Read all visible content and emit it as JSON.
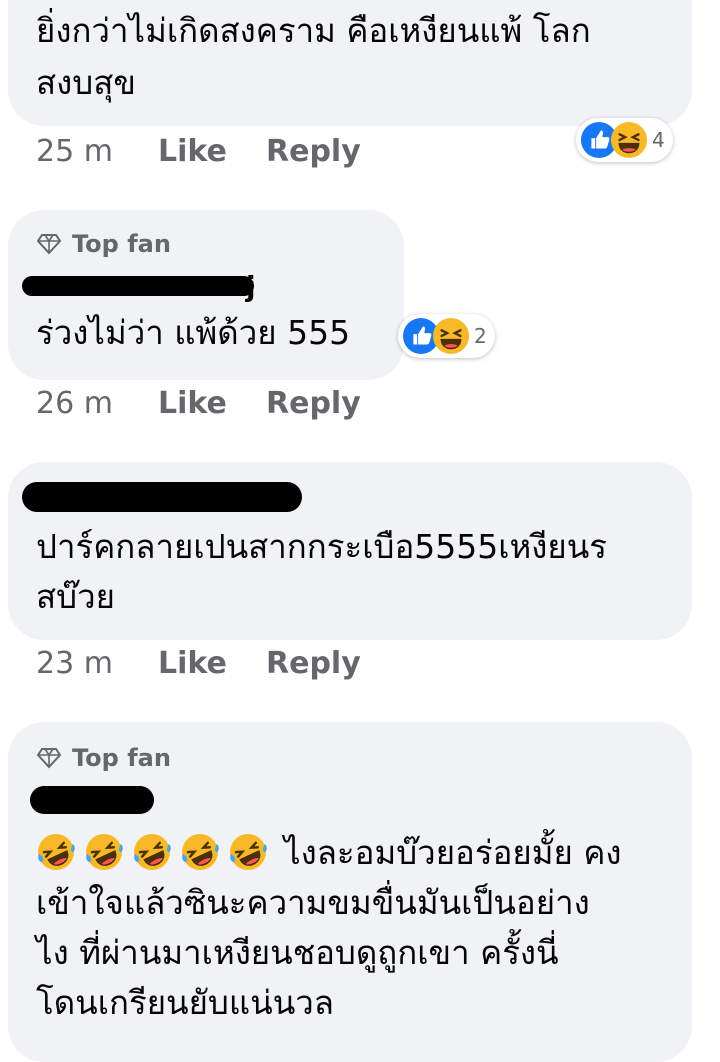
{
  "comments": [
    {
      "lines": [
        "ยิ่งกว่าไม่เกิดสงคราม คือเหงียนแพ้ โลก",
        "สงบสุข"
      ],
      "time": "25 m",
      "like": "Like",
      "reply": "Reply",
      "reaction_count": "4"
    },
    {
      "badge": "Top fan",
      "author_visible": "j",
      "lines": [
        "ร่วงไม่ว่า แพ้ด้วย 555"
      ],
      "time": "26 m",
      "like": "Like",
      "reply": "Reply",
      "reaction_count": "2"
    },
    {
      "lines": [
        "ปาร์คกลายเปนสากกระเบือ5555เหงียนร",
        "สบ๊วย"
      ],
      "time": "23 m",
      "like": "Like",
      "reply": "Reply"
    },
    {
      "badge": "Top fan",
      "lines": [
        "ไงละอมบ๊วยอร่อยมั้ย คง",
        "เข้าใจแล้วซินะความขมขื่นมันเป็นอย่าง",
        "ไง ที่ผ่านมาเหงียนชอบดูถูกเขา ครั้งนี่",
        "โดนเกรียนยับแน่นวล"
      ]
    }
  ],
  "icons": {
    "like": "thumbs-up-icon",
    "haha": "laughing-face-icon",
    "rofl": "rolling-on-floor-laughing-icon",
    "badge": "diamond-icon"
  },
  "colors": {
    "like_blue": "#1877f2",
    "meta_gray": "#65676b",
    "bubble": "#f0f2f5",
    "emoji_yellow": "#f7b928"
  }
}
